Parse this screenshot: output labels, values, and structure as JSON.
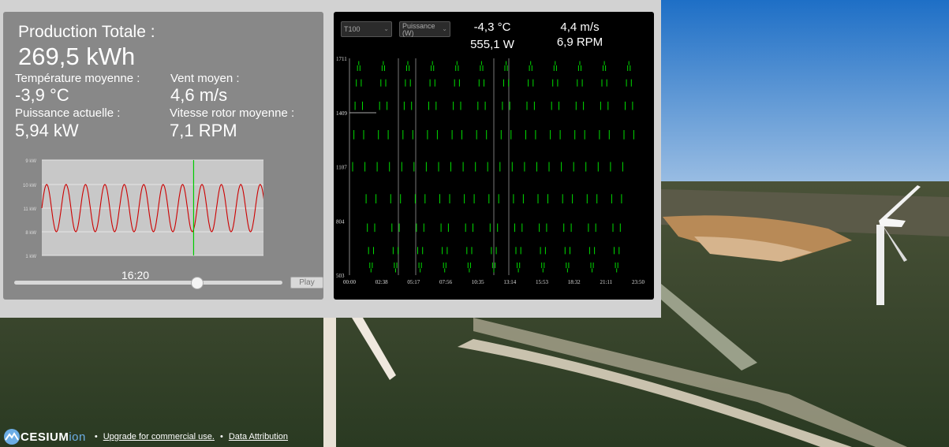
{
  "summary": {
    "production_label": "Production Totale :",
    "production_value": "269,5 kWh",
    "temp_label": "Température moyenne :",
    "temp_value": "-3,9 °C",
    "wind_label": "Vent moyen :",
    "wind_value": "4,6 m/s",
    "power_label": "Puissance actuelle :",
    "power_value": "5,94 kW",
    "rotor_label": "Vitesse rotor moyenne :",
    "rotor_value": "7,1 RPM"
  },
  "timeline": {
    "time": "16:20",
    "position": 0.68,
    "play_label": "Play"
  },
  "detail": {
    "turbine_select": "T100",
    "metric_select": "Puissance (W)",
    "temperature": "-4,3 °C",
    "power": "555,1 W",
    "wind": "4,4 m/s",
    "rotor": "6,9 RPM"
  },
  "credits": {
    "logo_text": "CESIUM",
    "logo_suffix": "ion",
    "upgrade_link": "Upgrade for commercial use.",
    "attribution_link": "Data Attribution"
  },
  "colors": {
    "mini_line": "#cc0000",
    "mini_cursor": "#00cc00",
    "main_marks": "#00dd00"
  },
  "chart_data": [
    {
      "type": "line",
      "ytick_labels": [
        "9 kW",
        "10 kW",
        "11 kW",
        "8 kW",
        "1 kW"
      ],
      "cycles": 11.5,
      "cursor_fraction": 0.68,
      "grid": true
    },
    {
      "type": "scatter",
      "yticks": [
        "1711",
        "1409",
        "1107",
        "804",
        "503"
      ],
      "xticks": [
        "00:00",
        "02:38",
        "05:17",
        "07:56",
        "10:35",
        "13:14",
        "15:53",
        "18:32",
        "21:11",
        "23:50"
      ],
      "ylim": [
        503,
        1711
      ],
      "cycles": 11.5,
      "grid": false
    }
  ]
}
